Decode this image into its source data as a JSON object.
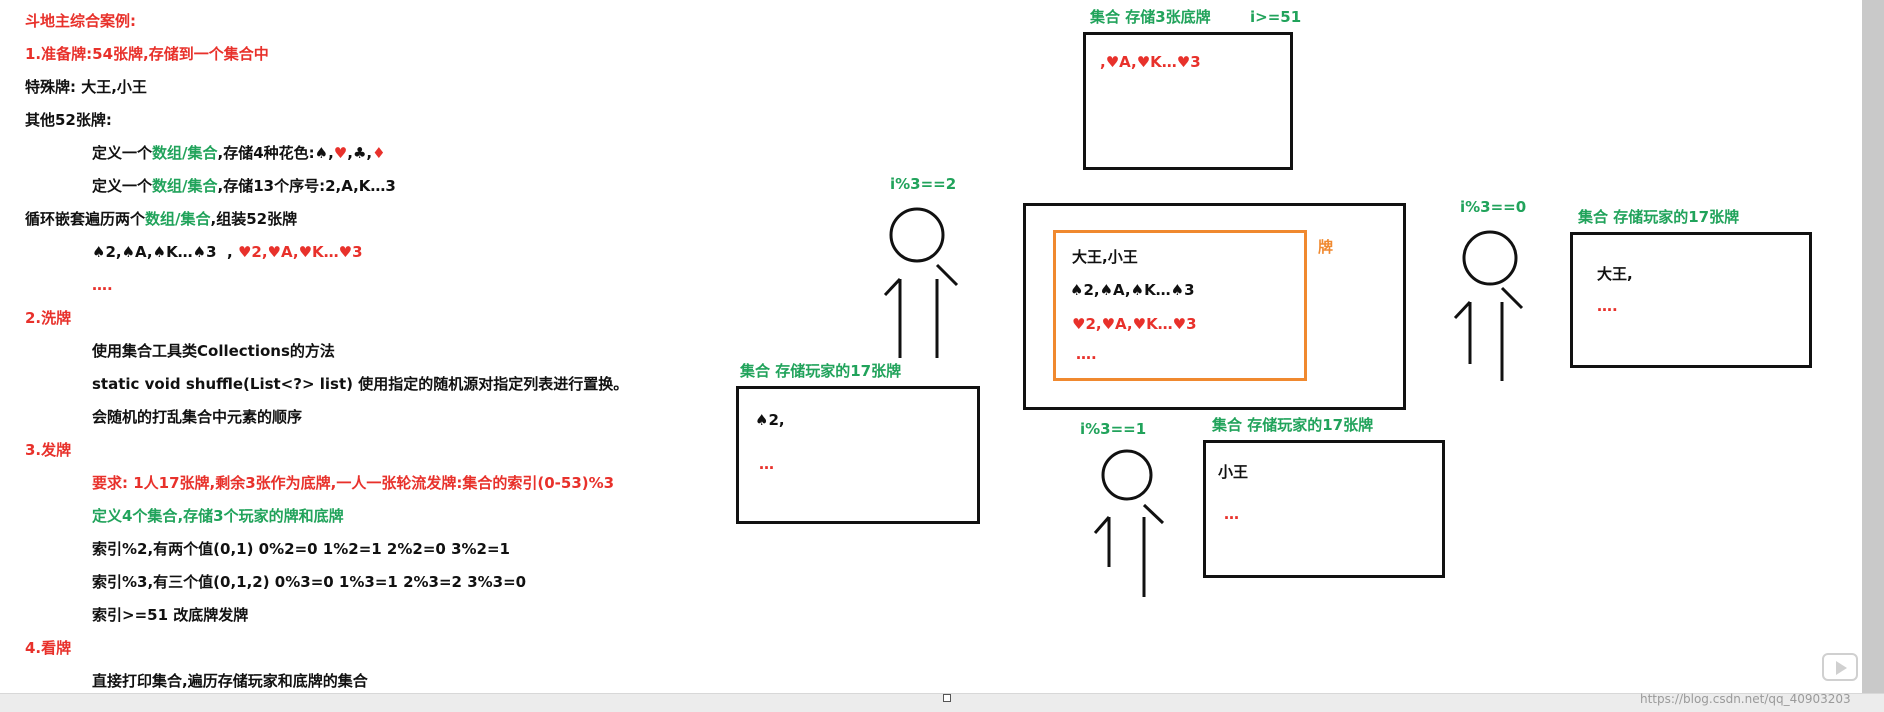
{
  "notes": {
    "title": "斗地主综合案例:",
    "s1_heading": "1.准备牌:54张牌,存储到一个集合中",
    "special": "特殊牌: 大王,小王",
    "other52": "其他52张牌:",
    "def1_a": "定义一个",
    "def1_b": "数组/集合",
    "def1_c": ",存储4种花色:",
    "suits": [
      "♠",
      "♥",
      "♣",
      "♦"
    ],
    "def2_a": "定义一个",
    "def2_b": "数组/集合",
    "def2_c": ",存储13个序号:2,A,K…3",
    "loop_a": "循环嵌套遍历两个",
    "loop_b": "数组/集合",
    "loop_c": ",组装52张牌",
    "cards_spade": "♠2,♠A,♠K…♠3",
    "cards_heart": "♥2,♥A,♥K…♥3",
    "cards_more": "….",
    "s2_heading": "2.洗牌",
    "s2_line1": "使用集合工具类Collections的方法",
    "s2_line2": "static void shuffle(List<?> list) 使用指定的随机源对指定列表进行置换。",
    "s2_line3": "会随机的打乱集合中元素的顺序",
    "s3_heading": "3.发牌",
    "s3_req": "要求: 1人17张牌,剩余3张作为底牌,一人一张轮流发牌:集合的索引(0-53)%3",
    "s3_def": "定义4个集合,存储3个玩家的牌和底牌",
    "s3_idx2": "索引%2,有两个值(0,1) 0%2=0 1%2=1 2%2=0 3%2=1",
    "s3_idx3": "索引%3,有三个值(0,1,2) 0%3=0 1%3=1 2%3=2 3%3=0",
    "s3_idx51": "索引>=51 改底牌发牌",
    "s4_heading": "4.看牌",
    "s4_line1": "直接打印集合,遍历存储玩家和底牌的集合"
  },
  "diagram": {
    "bottom_label": "集合 存储3张底牌",
    "bottom_cond": "i>=51",
    "bottom_content": ",♥A,♥K…♥3",
    "deck_label": "牌",
    "deck_line1": "大王,小王",
    "deck_line2": "♠2,♠A,♠K…♠3",
    "deck_line3": "♥2,♥A,♥K…♥3",
    "deck_line4": "….",
    "p_left_cond": "i%3==2",
    "p_left_label": "集合 存储玩家的17张牌",
    "p_left_card": "♠2,",
    "p_left_more": "…",
    "p_right_cond": "i%3==0",
    "p_right_label": "集合 存储玩家的17张牌",
    "p_right_card": "大王,",
    "p_right_more": "….",
    "p_mid_cond": "i%3==1",
    "p_mid_label": "集合 存储玩家的17张牌",
    "p_mid_card": "小王",
    "p_mid_more": "…",
    "watermark": "https://blog.csdn.net/qq_40903203"
  },
  "colors": {
    "red": "#e8312b",
    "green": "#21a35b",
    "orange": "#f0892f",
    "black": "#111111"
  }
}
